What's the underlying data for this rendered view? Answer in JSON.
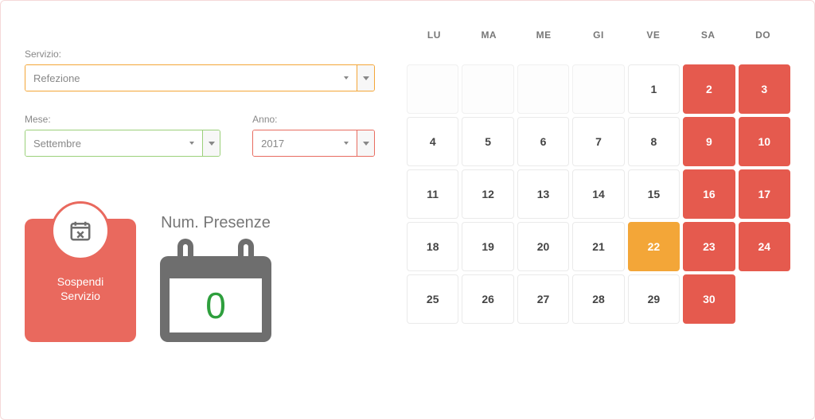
{
  "form": {
    "servizio_label": "Servizio:",
    "servizio_value": "Refezione",
    "mese_label": "Mese:",
    "mese_value": "Settembre",
    "anno_label": "Anno:",
    "anno_value": "2017"
  },
  "suspend": {
    "line1": "Sospendi",
    "line2": "Servizio"
  },
  "presenze": {
    "label": "Num. Presenze",
    "value": "0"
  },
  "calendar": {
    "weekdays": [
      "LU",
      "MA",
      "ME",
      "GI",
      "VE",
      "SA",
      "DO"
    ],
    "leading_empty": 4,
    "days": [
      {
        "n": 1,
        "state": "normal"
      },
      {
        "n": 2,
        "state": "red"
      },
      {
        "n": 3,
        "state": "red"
      },
      {
        "n": 4,
        "state": "normal"
      },
      {
        "n": 5,
        "state": "normal"
      },
      {
        "n": 6,
        "state": "normal"
      },
      {
        "n": 7,
        "state": "normal"
      },
      {
        "n": 8,
        "state": "normal"
      },
      {
        "n": 9,
        "state": "red"
      },
      {
        "n": 10,
        "state": "red"
      },
      {
        "n": 11,
        "state": "normal"
      },
      {
        "n": 12,
        "state": "normal"
      },
      {
        "n": 13,
        "state": "normal"
      },
      {
        "n": 14,
        "state": "normal"
      },
      {
        "n": 15,
        "state": "normal"
      },
      {
        "n": 16,
        "state": "red"
      },
      {
        "n": 17,
        "state": "red"
      },
      {
        "n": 18,
        "state": "normal"
      },
      {
        "n": 19,
        "state": "normal"
      },
      {
        "n": 20,
        "state": "normal"
      },
      {
        "n": 21,
        "state": "normal"
      },
      {
        "n": 22,
        "state": "orange"
      },
      {
        "n": 23,
        "state": "red"
      },
      {
        "n": 24,
        "state": "red"
      },
      {
        "n": 25,
        "state": "normal"
      },
      {
        "n": 26,
        "state": "normal"
      },
      {
        "n": 27,
        "state": "normal"
      },
      {
        "n": 28,
        "state": "normal"
      },
      {
        "n": 29,
        "state": "normal"
      },
      {
        "n": 30,
        "state": "red"
      }
    ]
  }
}
